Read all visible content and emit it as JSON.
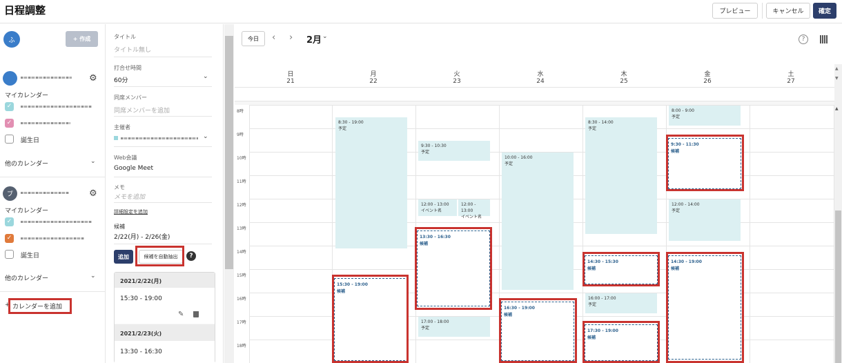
{
  "app": {
    "title": "日程調整",
    "preview": "プレビュー",
    "cancel": "キャンセル",
    "confirm": "確定"
  },
  "left": {
    "user_initial": "ふ",
    "create": "+ 作成",
    "account2_initial": "ブ",
    "mycal": "マイカレンダー",
    "birthday": "誕生日",
    "othercal": "他のカレンダー",
    "add_calendar": "カレンダーを追加"
  },
  "form": {
    "title_label": "タイトル",
    "title_placeholder": "タイトル無し",
    "duration_label": "打合せ時間",
    "duration_value": "60分",
    "members_label": "同席メンバー",
    "members_placeholder": "同席メンバーを追加",
    "organizer_label": "主催者",
    "web_label": "Web会議",
    "web_value": "Google Meet",
    "memo_label": "メモ",
    "memo_placeholder": "メモを追加",
    "detail_link": "詳細設定を追加",
    "cand_label": "候補",
    "cand_range": "2/22(月) - 2/26(金)",
    "add_btn": "追加",
    "auto_btn": "候補を自動抽出",
    "help": "?",
    "cand_list": [
      {
        "date": "2021/2/22(月)",
        "time": "15:30 - 19:00"
      },
      {
        "date": "2021/2/23(火)",
        "time": "13:30 - 16:30"
      }
    ]
  },
  "cal": {
    "today": "今日",
    "prev": "‹",
    "next": "›",
    "month": "2月",
    "help_icon": "?",
    "days": [
      {
        "name": "日",
        "num": "21"
      },
      {
        "name": "月",
        "num": "22"
      },
      {
        "name": "火",
        "num": "23"
      },
      {
        "name": "水",
        "num": "24"
      },
      {
        "name": "木",
        "num": "25"
      },
      {
        "name": "金",
        "num": "26"
      },
      {
        "name": "土",
        "num": "27"
      }
    ],
    "hours": [
      "8時",
      "9時",
      "10時",
      "11時",
      "12時",
      "13時",
      "14時",
      "15時",
      "16時",
      "17時",
      "18時"
    ],
    "events": [
      {
        "time": "8:30 - 19:00",
        "label": "予定"
      },
      {
        "time": "9:30 - 10:30",
        "label": "予定"
      },
      {
        "time": "12:00 - 13:00",
        "label": "イベント名"
      },
      {
        "time": "12:00 - 13:00",
        "label": "イベント名"
      },
      {
        "time": "17:00 - 18:00",
        "label": "予定"
      },
      {
        "time": "10:00 - 16:00",
        "label": "予定"
      },
      {
        "time": "8:30 - 14:00",
        "label": "予定"
      },
      {
        "time": "16:00 - 17:00",
        "label": "予定"
      },
      {
        "time": "8:00 - 9:00",
        "label": "予定"
      },
      {
        "time": "12:00 - 14:00",
        "label": "予定"
      }
    ],
    "candidates": [
      {
        "time": "15:30 - 19:00",
        "label": "候補"
      },
      {
        "time": "13:30 - 16:30",
        "label": "候補"
      },
      {
        "time": "16:30 - 19:00",
        "label": "候補"
      },
      {
        "time": "14:30 - 15:30",
        "label": "候補"
      },
      {
        "time": "17:30 - 19:00",
        "label": "候補"
      },
      {
        "time": "9:30 - 11:30",
        "label": "候補"
      },
      {
        "time": "14:30 - 19:00",
        "label": "候補"
      }
    ]
  },
  "colors": {
    "accent": "#2c3e6b",
    "event": "#dcf0f2",
    "highlight": "#c9332f",
    "candidate": "#2b5f8c"
  }
}
